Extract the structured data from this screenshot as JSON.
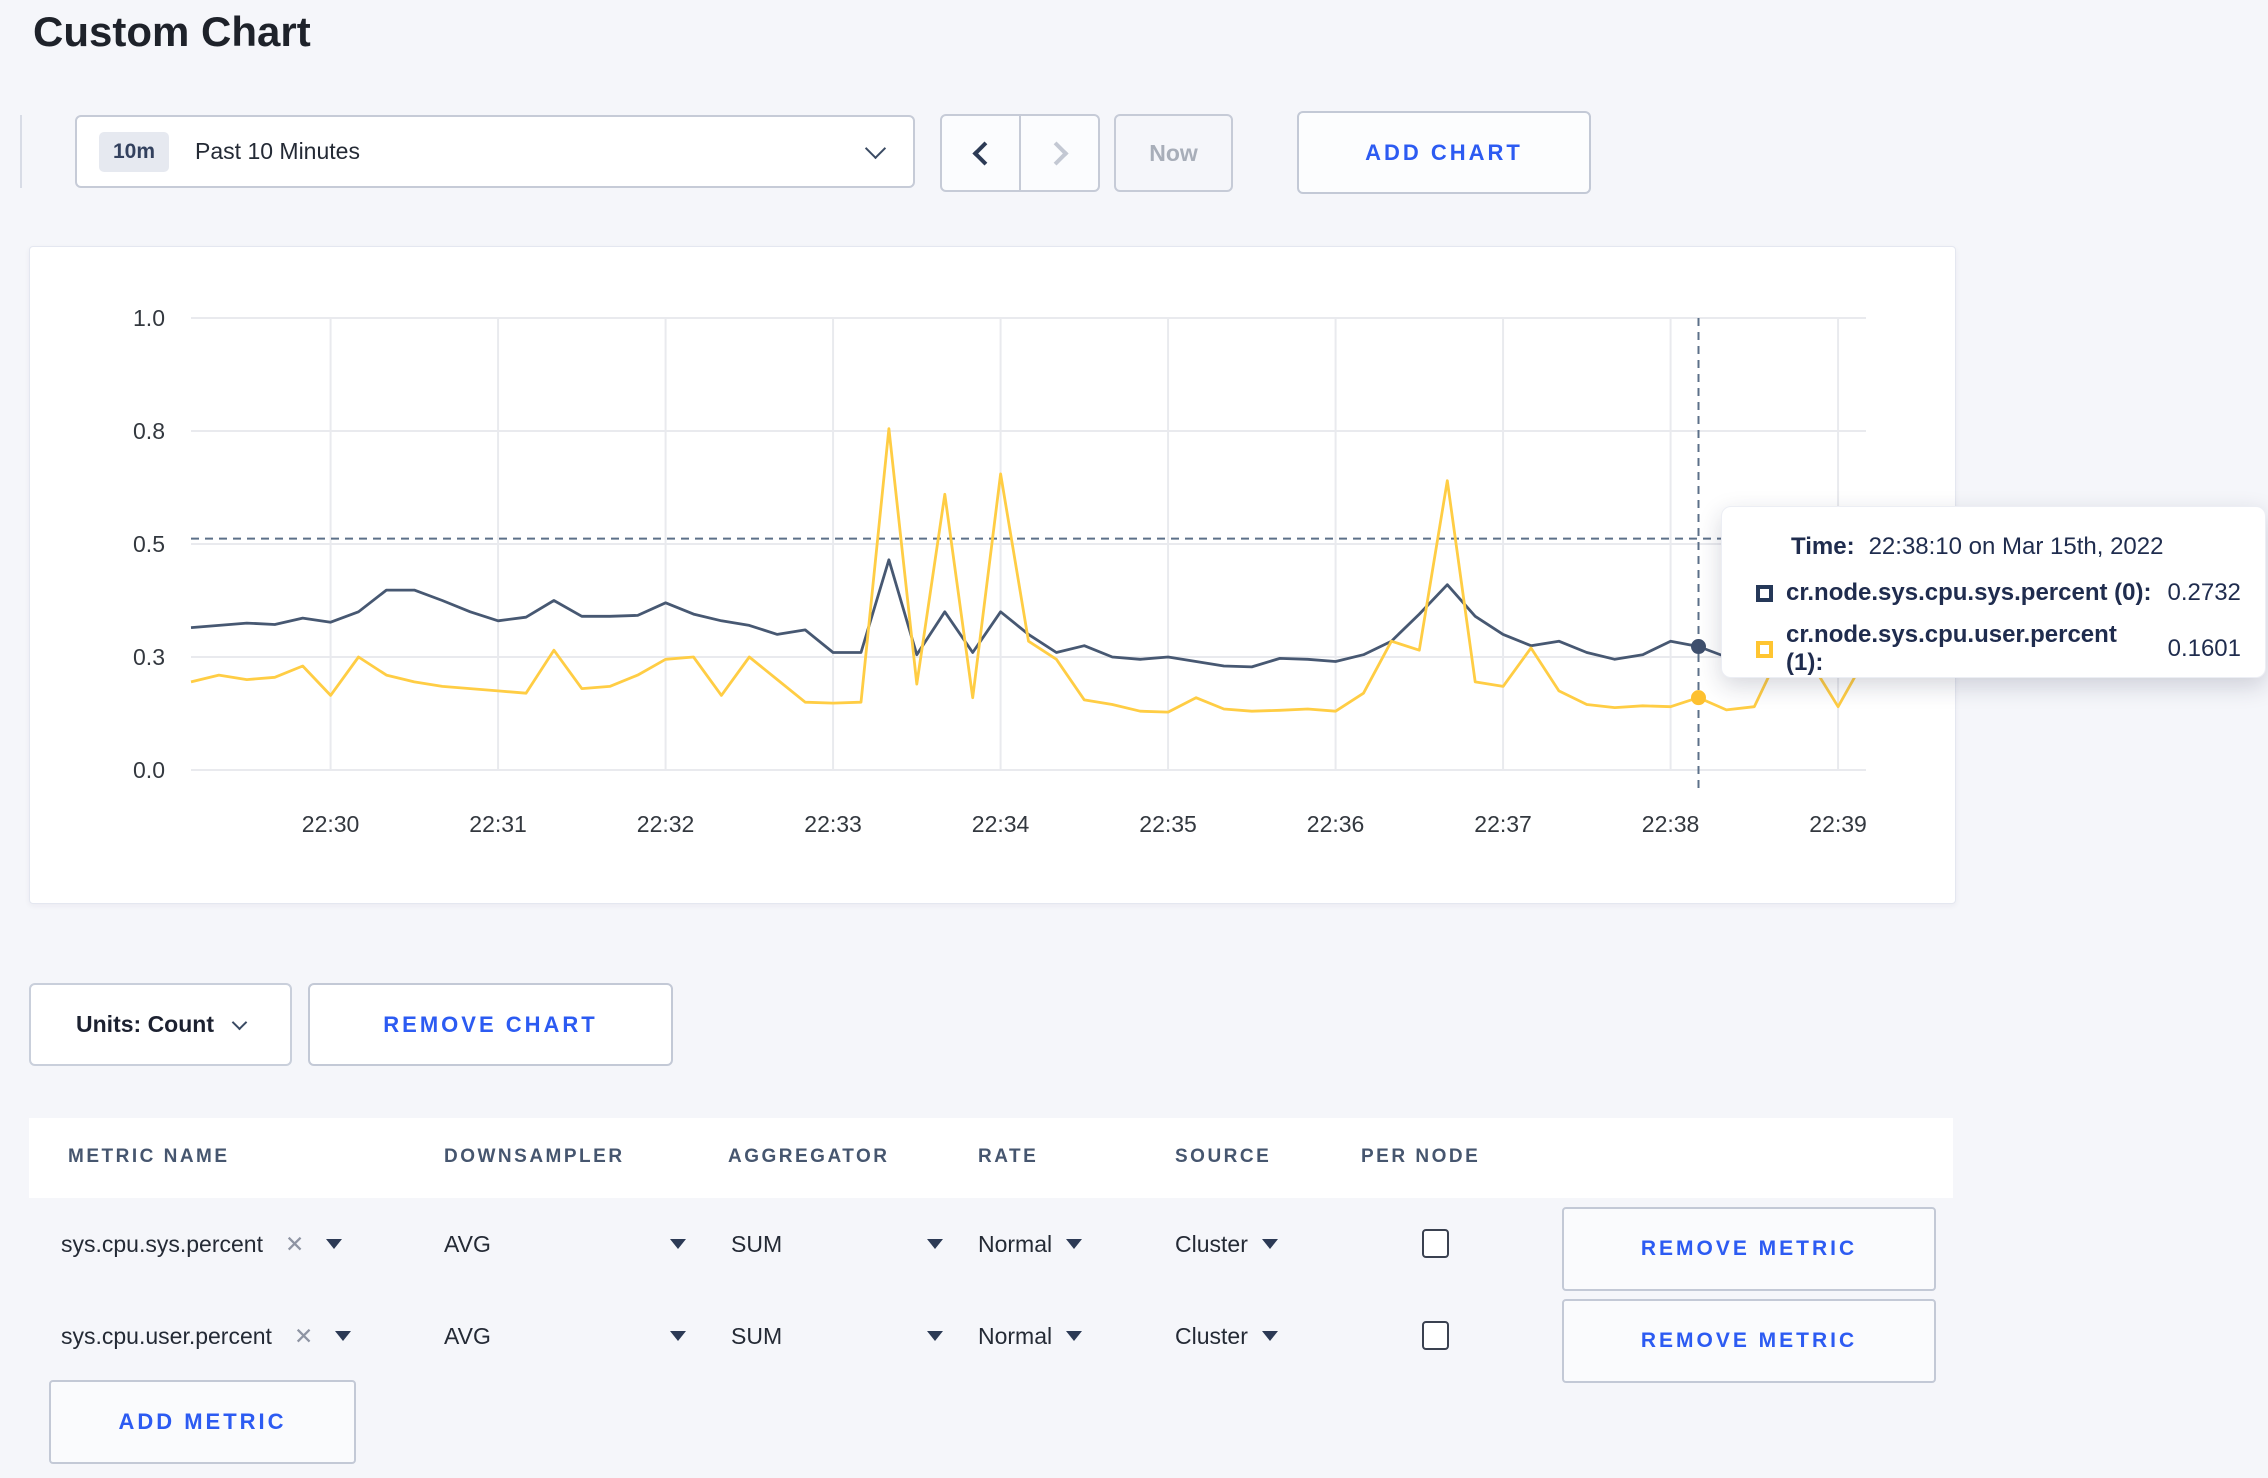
{
  "page": {
    "title": "Custom Chart",
    "background": "#f5f6fa",
    "accent_blue": "#2c5bf2"
  },
  "toolbar": {
    "time_range": {
      "badge": "10m",
      "label": "Past 10 Minutes"
    },
    "now_label": "Now",
    "add_chart_label": "ADD CHART"
  },
  "chart_data": {
    "type": "line",
    "x_start": "22:29:10",
    "x_step_sec": 10,
    "xlabel": "",
    "ylabel": "",
    "ylim": [
      0,
      1
    ],
    "grid": true,
    "x_ticks": [
      {
        "label": "22:30",
        "time": "22:30:00"
      },
      {
        "label": "22:31",
        "time": "22:31:00"
      },
      {
        "label": "22:32",
        "time": "22:32:00"
      },
      {
        "label": "22:33",
        "time": "22:33:00"
      },
      {
        "label": "22:34",
        "time": "22:34:00"
      },
      {
        "label": "22:35",
        "time": "22:35:00"
      },
      {
        "label": "22:36",
        "time": "22:36:00"
      },
      {
        "label": "22:37",
        "time": "22:37:00"
      },
      {
        "label": "22:38",
        "time": "22:38:00"
      },
      {
        "label": "22:39",
        "time": "22:39:00"
      }
    ],
    "y_ticks": [
      {
        "label": "1.0",
        "value": 1.0
      },
      {
        "label": "0.8",
        "value": 0.75
      },
      {
        "label": "0.5",
        "value": 0.5
      },
      {
        "label": "0.3",
        "value": 0.25
      },
      {
        "label": "0.0",
        "value": 0.0
      }
    ],
    "series": [
      {
        "name": "cr.node.sys.cpu.sys.percent (0)",
        "color": "#475872",
        "values": [
          0.315,
          0.32,
          0.325,
          0.322,
          0.336,
          0.327,
          0.35,
          0.398,
          0.398,
          0.375,
          0.35,
          0.33,
          0.338,
          0.375,
          0.34,
          0.34,
          0.342,
          0.37,
          0.345,
          0.33,
          0.32,
          0.3,
          0.31,
          0.26,
          0.26,
          0.465,
          0.255,
          0.35,
          0.26,
          0.35,
          0.3,
          0.26,
          0.275,
          0.25,
          0.245,
          0.25,
          0.24,
          0.23,
          0.228,
          0.247,
          0.245,
          0.24,
          0.255,
          0.285,
          0.345,
          0.41,
          0.34,
          0.3,
          0.275,
          0.285,
          0.26,
          0.245,
          0.255,
          0.285,
          0.2732,
          0.25,
          0.26,
          0.27,
          0.26,
          0.275,
          0.285
        ]
      },
      {
        "name": "cr.node.sys.cpu.user.percent (1)",
        "color": "#ffcd44",
        "values": [
          0.195,
          0.21,
          0.2,
          0.205,
          0.23,
          0.165,
          0.25,
          0.21,
          0.195,
          0.185,
          0.18,
          0.175,
          0.17,
          0.265,
          0.18,
          0.185,
          0.21,
          0.245,
          0.25,
          0.165,
          0.25,
          0.2,
          0.15,
          0.148,
          0.15,
          0.755,
          0.19,
          0.61,
          0.16,
          0.655,
          0.285,
          0.245,
          0.155,
          0.145,
          0.13,
          0.128,
          0.16,
          0.135,
          0.13,
          0.132,
          0.135,
          0.13,
          0.17,
          0.285,
          0.265,
          0.64,
          0.195,
          0.185,
          0.27,
          0.175,
          0.145,
          0.138,
          0.142,
          0.14,
          0.1601,
          0.133,
          0.14,
          0.27,
          0.24,
          0.14,
          0.25
        ]
      }
    ],
    "crosshair": {
      "time": "22:38:10",
      "hline_value": 0.512,
      "values": [
        0.2732,
        0.1601
      ],
      "dot_colors": [
        "#3e4f6d",
        "#fdc02f"
      ],
      "dash_color": "#5c7089"
    },
    "grid_color": "#e9eaee",
    "tick_text_color": "#33383f"
  },
  "tooltip": {
    "time_label": "Time:",
    "time_value": "22:38:10 on Mar 15th, 2022",
    "rows": [
      {
        "name": "cr.node.sys.cpu.sys.percent (0):",
        "value": "0.2732",
        "color": "#253858"
      },
      {
        "name": "cr.node.sys.cpu.user.percent (1):",
        "value": "0.1601",
        "color": "#ffc531"
      }
    ]
  },
  "chart_controls": {
    "units_label": "Units: Count",
    "remove_chart_label": "REMOVE CHART"
  },
  "metrics_table": {
    "headers": [
      "METRIC NAME",
      "DOWNSAMPLER",
      "AGGREGATOR",
      "RATE",
      "SOURCE",
      "PER NODE"
    ],
    "rows": [
      {
        "metric_name": "sys.cpu.sys.percent",
        "downsampler": "AVG",
        "aggregator": "SUM",
        "rate": "Normal",
        "source": "Cluster",
        "per_node_checked": false,
        "remove_label": "REMOVE METRIC"
      },
      {
        "metric_name": "sys.cpu.user.percent",
        "downsampler": "AVG",
        "aggregator": "SUM",
        "rate": "Normal",
        "source": "Cluster",
        "per_node_checked": false,
        "remove_label": "REMOVE METRIC"
      }
    ],
    "add_metric_label": "ADD METRIC"
  }
}
